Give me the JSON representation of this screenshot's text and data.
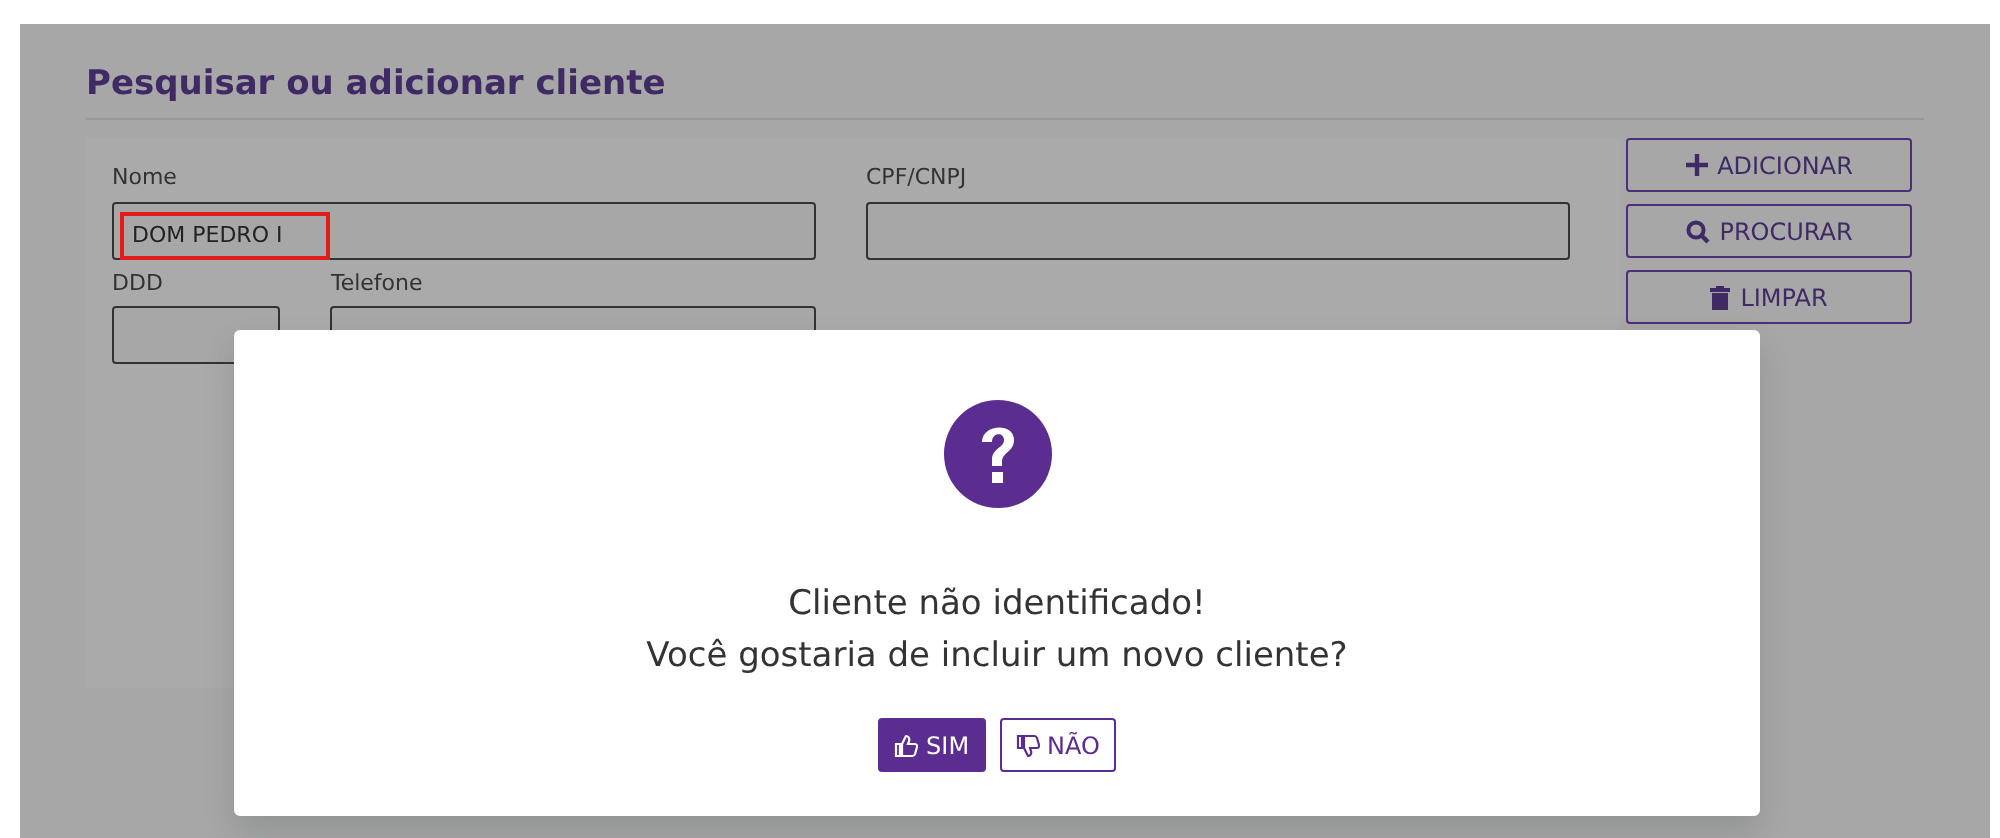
{
  "page": {
    "title": "Pesquisar ou adicionar cliente"
  },
  "form": {
    "fields": [
      {
        "label": "Nome",
        "value": "DOM PEDRO I",
        "highlighted": true
      },
      {
        "label": "CPF/CNPJ"
      },
      {
        "label": "DDD"
      },
      {
        "label": "Telefone"
      }
    ]
  },
  "actions": [
    {
      "kind": "add",
      "label": "ADICIONAR"
    },
    {
      "kind": "search",
      "label": "PROCURAR"
    },
    {
      "kind": "clear",
      "label": "LIMPAR"
    }
  ],
  "dialog": {
    "lines": [
      "Cliente não identificado!",
      "Você gostaria de incluir um novo cliente?"
    ],
    "buttons": [
      {
        "kind": "yes",
        "label": "SIM",
        "primary": true
      },
      {
        "kind": "no",
        "label": "NÃO",
        "primary": false
      }
    ]
  }
}
